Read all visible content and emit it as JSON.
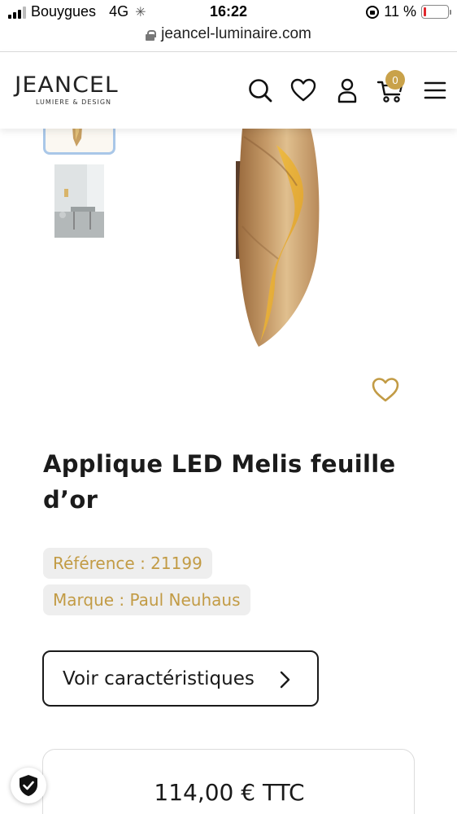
{
  "status_bar": {
    "carrier": "Bouygues",
    "network": "4G",
    "time": "16:22",
    "battery_percent": "11 %",
    "battery_level": 0.11
  },
  "browser": {
    "url": "jeancel-luminaire.com"
  },
  "header": {
    "logo_main": "JEANCEL",
    "logo_sub": "LUMIERE & DESIGN",
    "cart_count": "0",
    "accent_color": "#c9a24a"
  },
  "product": {
    "title": "Applique LED Melis feuille d’or",
    "reference": "Référence : 21199",
    "brand": "Marque : Paul Neuhaus",
    "specs_button": "Voir caractéristiques",
    "price": "114,00 € TTC"
  },
  "icons": {
    "search": "search-icon",
    "wishlist": "heart-icon",
    "account": "user-icon",
    "cart": "cart-icon",
    "menu": "hamburger-menu-icon",
    "favorite": "heart-outline-icon",
    "chevron": "chevron-right-icon",
    "trust": "shield-check-icon"
  }
}
